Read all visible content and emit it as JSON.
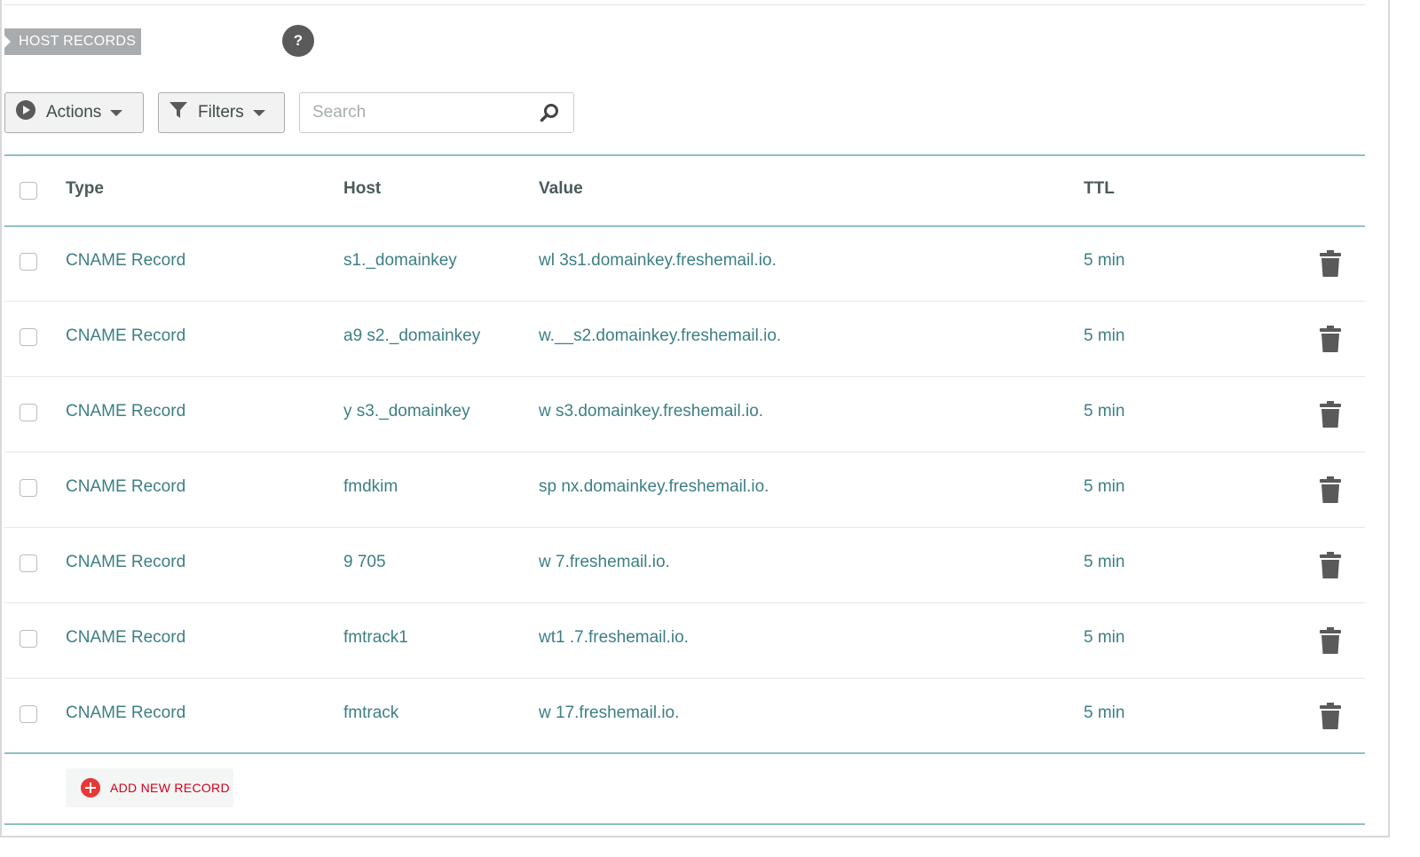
{
  "section": {
    "title": "HOST RECORDS",
    "help_label": "?"
  },
  "toolbar": {
    "actions_label": "Actions",
    "filters_label": "Filters",
    "search_placeholder": "Search",
    "icons": {
      "actions": "play-circle-icon",
      "filters": "funnel-icon",
      "search": "magnifier-icon"
    }
  },
  "table": {
    "columns": {
      "type": "Type",
      "host": "Host",
      "value": "Value",
      "ttl": "TTL"
    },
    "rows": [
      {
        "type": "CNAME Record",
        "host": "s1._domainkey",
        "value": "wl 3s1.domainkey.freshemail.io.",
        "ttl": "5 min"
      },
      {
        "type": "CNAME Record",
        "host": "a9 s2._domainkey",
        "value": "w.__s2.domainkey.freshemail.io.",
        "ttl": "5 min"
      },
      {
        "type": "CNAME Record",
        "host": "y s3._domainkey",
        "value": "w s3.domainkey.freshemail.io.",
        "ttl": "5 min"
      },
      {
        "type": "CNAME Record",
        "host": "fmdkim",
        "value": "sp nx.domainkey.freshemail.io.",
        "ttl": "5 min"
      },
      {
        "type": "CNAME Record",
        "host": "9 705",
        "value": "w 7.freshemail.io.",
        "ttl": "5 min"
      },
      {
        "type": "CNAME Record",
        "host": "fmtrack1",
        "value": "wt1 .7.freshemail.io.",
        "ttl": "5 min"
      },
      {
        "type": "CNAME Record",
        "host": "fmtrack",
        "value": "w 17.freshemail.io.",
        "ttl": "5 min"
      }
    ]
  },
  "footer": {
    "add_label": "ADD NEW RECORD"
  },
  "colors": {
    "accent_teal": "#3d7f84",
    "divider": "#8fbfc6",
    "add_red": "#d0021b"
  }
}
